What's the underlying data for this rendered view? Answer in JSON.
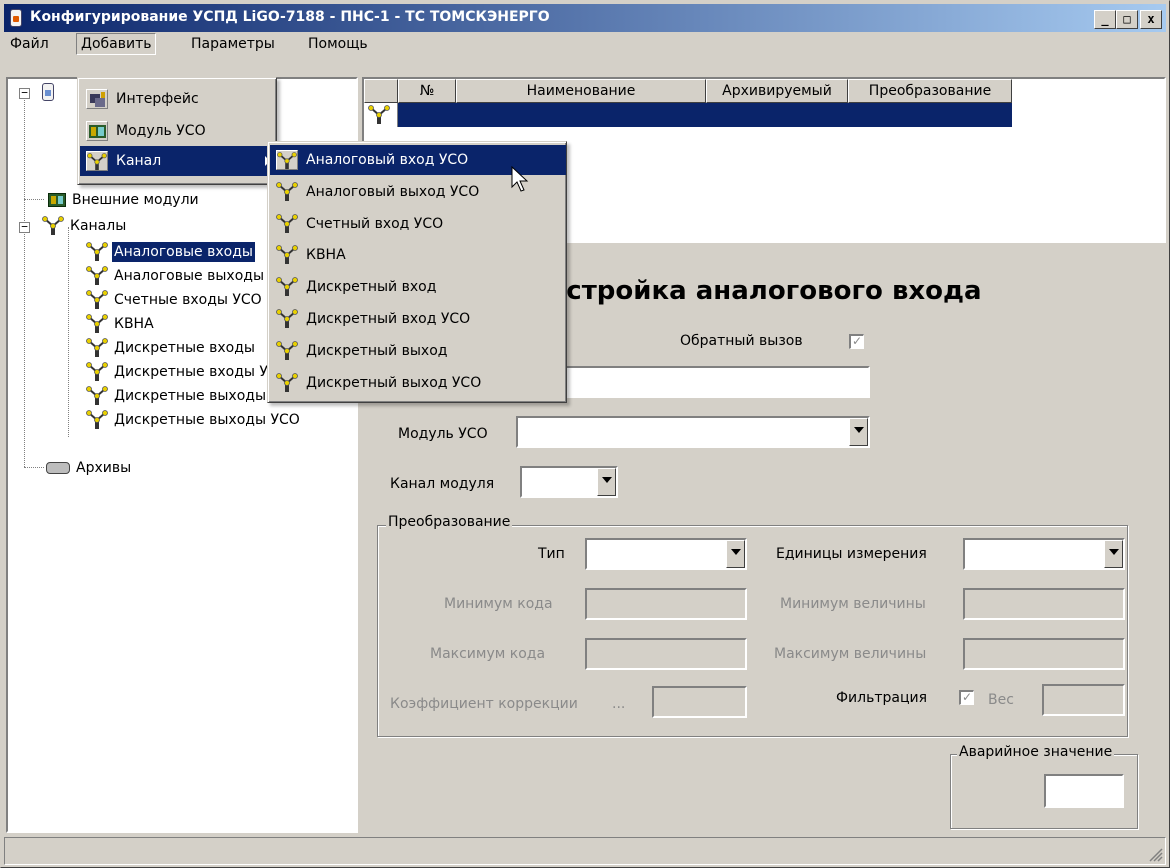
{
  "window": {
    "title": "Конфигурирование УСПД LiGO-7188 - ПНС-1 - ТС ТОМСКЭНЕРГО",
    "buttons": [
      "_",
      "□",
      "x"
    ]
  },
  "menubar": {
    "items": [
      "Файл",
      "Добавить",
      "Параметры",
      "Помощь"
    ]
  },
  "add_menu": {
    "items": [
      "Интерфейс",
      "Модуль УСО",
      "Канал"
    ]
  },
  "channel_submenu": {
    "items": [
      "Аналоговый вход УСО",
      "Аналоговый выход УСО",
      "Счетный вход УСО",
      "КВНА",
      "Дискретный вход",
      "Дискретный вход УСО",
      "Дискретный выход",
      "Дискретный выход УСО"
    ],
    "highlighted_index": 0
  },
  "tree": {
    "external_modules": "Внешние модули",
    "channels": "Каналы",
    "channel_children": [
      "Аналоговые входы",
      "Аналоговые выходы",
      "Счетные входы УСО",
      "КВНА",
      "Дискретные входы",
      "Дискретные входы УСО",
      "Дискретные выходы",
      "Дискретные выходы УСО"
    ],
    "archives": "Архивы"
  },
  "grid": {
    "columns": [
      "№",
      "Наименование",
      "Архивируемый",
      "Преобразование"
    ]
  },
  "form": {
    "title": "Настройка аналогового входа",
    "callback_label": "Обратный вызов",
    "callback_checked": true,
    "name_value": "",
    "module_label": "Модуль УСО",
    "module_value": "",
    "channel_label": "Канал модуля",
    "channel_value": "",
    "conversion_group": "Преобразование",
    "type_label": "Тип",
    "units_label": "Единицы измерения",
    "min_code_label": "Минимум кода",
    "min_value_label": "Минимум величины",
    "max_code_label": "Максимум кода",
    "max_value_label": "Максимум величины",
    "correction_label": "Коэффициент коррекции",
    "correction_ellipsis": "...",
    "filter_label": "Фильтрация",
    "filter_checked": true,
    "weight_label": "Вес",
    "alarm_group": "Аварийное значение"
  },
  "colors": {
    "selection": "#0a246a",
    "face": "#d4d0c8"
  }
}
